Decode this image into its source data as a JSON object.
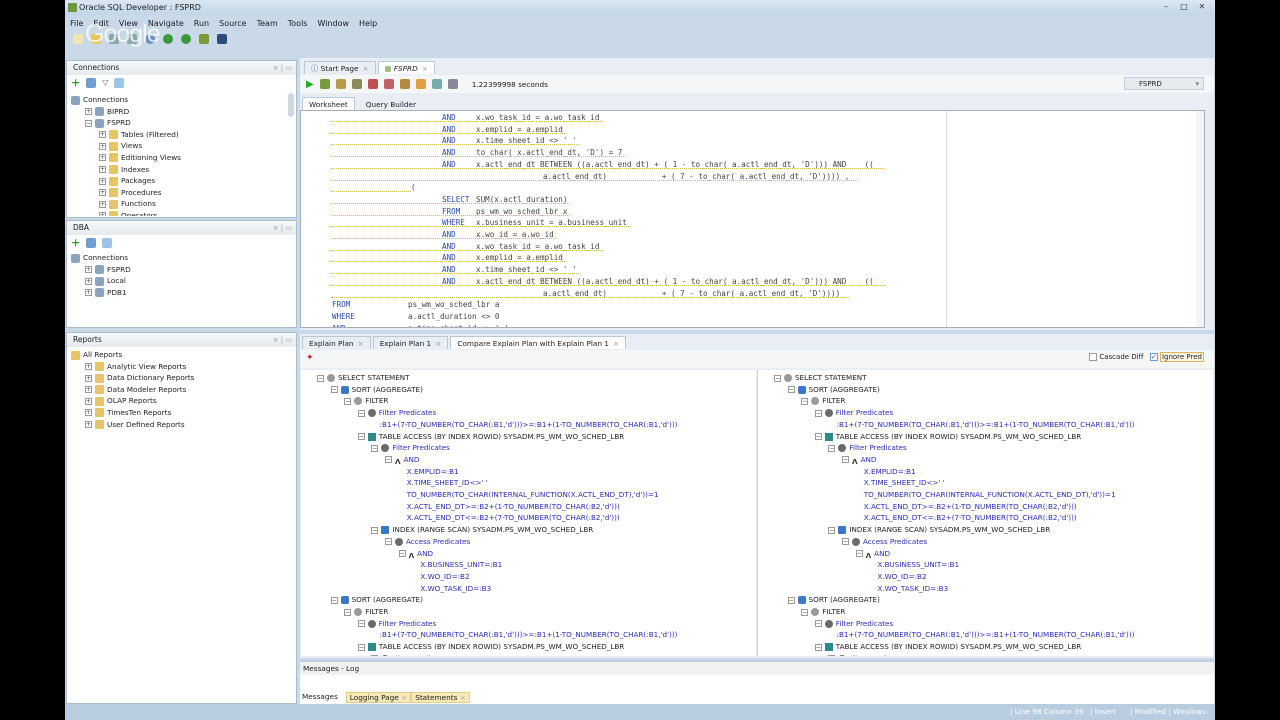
{
  "window": {
    "title": "Oracle SQL Developer : FSPRD",
    "watermark": "Google"
  },
  "menu": [
    "File",
    "Edit",
    "View",
    "Navigate",
    "Run",
    "Source",
    "Team",
    "Tools",
    "Window",
    "Help"
  ],
  "connections_panel": {
    "title": "Connections",
    "tree": [
      {
        "label": "Connections",
        "level": 0,
        "icon": "connections",
        "exp": ""
      },
      {
        "label": "BIPRD",
        "level": 1,
        "icon": "db",
        "exp": "+"
      },
      {
        "label": "FSPRD",
        "level": 1,
        "icon": "db",
        "exp": "-"
      },
      {
        "label": "Tables (Filtered)",
        "level": 2,
        "icon": "folder",
        "exp": "+"
      },
      {
        "label": "Views",
        "level": 2,
        "icon": "folder",
        "exp": "+"
      },
      {
        "label": "Editioning Views",
        "level": 2,
        "icon": "folder",
        "exp": "+"
      },
      {
        "label": "Indexes",
        "level": 2,
        "icon": "folder",
        "exp": "+"
      },
      {
        "label": "Packages",
        "level": 2,
        "icon": "folder",
        "exp": "+"
      },
      {
        "label": "Procedures",
        "level": 2,
        "icon": "folder",
        "exp": "+"
      },
      {
        "label": "Functions",
        "level": 2,
        "icon": "folder",
        "exp": "+"
      },
      {
        "label": "Operators",
        "level": 2,
        "icon": "folder",
        "exp": "+"
      }
    ]
  },
  "dba_panel": {
    "title": "DBA",
    "tree": [
      {
        "label": "Connections",
        "level": 0,
        "icon": "connections",
        "exp": ""
      },
      {
        "label": "FSPRD",
        "level": 1,
        "icon": "db",
        "exp": "+"
      },
      {
        "label": "Local",
        "level": 1,
        "icon": "db",
        "exp": "+"
      },
      {
        "label": "PDB1",
        "level": 1,
        "icon": "db",
        "exp": "+"
      }
    ]
  },
  "reports_panel": {
    "title": "Reports",
    "tree": [
      {
        "label": "All Reports",
        "level": 0,
        "icon": "folder",
        "exp": ""
      },
      {
        "label": "Analytic View Reports",
        "level": 1,
        "icon": "folder",
        "exp": "+"
      },
      {
        "label": "Data Dictionary Reports",
        "level": 1,
        "icon": "folder",
        "exp": "+"
      },
      {
        "label": "Data Modeler Reports",
        "level": 1,
        "icon": "folder",
        "exp": "+"
      },
      {
        "label": "OLAP Reports",
        "level": 1,
        "icon": "folder",
        "exp": "+"
      },
      {
        "label": "TimesTen Reports",
        "level": 1,
        "icon": "folder",
        "exp": "+"
      },
      {
        "label": "User Defined Reports",
        "level": 1,
        "icon": "folder",
        "exp": "+"
      }
    ]
  },
  "editor_tabs": [
    {
      "label": "Start Page",
      "active": false
    },
    {
      "label": "FSPRD",
      "active": true
    }
  ],
  "editor_toolbar": {
    "elapsed": "1.22399998 seconds",
    "connection": "FSPRD"
  },
  "worksheet_tabs": [
    "Worksheet",
    "Query Builder"
  ],
  "code_lines": [
    {
      "col": "inner",
      "kw": "AND",
      "code": "x.wo_task_id = a.wo_task_id"
    },
    {
      "col": "inner",
      "kw": "AND",
      "code": "x.emplid = a.emplid"
    },
    {
      "col": "inner",
      "kw": "AND",
      "code": "x.time_sheet_id <> ' '"
    },
    {
      "col": "inner",
      "kw": "AND",
      "code": "to_char( x.actl_end_dt, 'D') = 7"
    },
    {
      "col": "inner",
      "kw": "AND",
      "code": "x.actl_end_dt BETWEEN ((a.actl_end_dt) + ( 1 - to_char( a.actl_end_dt, 'D'))) AND    (("
    },
    {
      "col": "cont",
      "kw": "",
      "code": "a.actl_end_dt)            + ( 7 - to_char( a.actl_end_dt, 'D')))) ,"
    },
    {
      "col": "paren",
      "kw": "",
      "code": "("
    },
    {
      "col": "inner",
      "kw": "SELECT",
      "code": "SUM(x.actl_duration)"
    },
    {
      "col": "inner",
      "kw": "FROM",
      "code": "ps_wm_wo_sched_lbr x"
    },
    {
      "col": "inner",
      "kw": "WHERE",
      "code": "x.business_unit = a.business_unit"
    },
    {
      "col": "inner",
      "kw": "AND",
      "code": "x.wo_id = a.wo_id"
    },
    {
      "col": "inner",
      "kw": "AND",
      "code": "x.wo_task_id = a.wo_task_id"
    },
    {
      "col": "inner",
      "kw": "AND",
      "code": "x.emplid = a.emplid"
    },
    {
      "col": "inner",
      "kw": "AND",
      "code": "x.time_sheet_id <> ' '"
    },
    {
      "col": "inner",
      "kw": "AND",
      "code": "x.actl_end_dt BETWEEN ((a.actl_end_dt) + ( 1 - to_char( a.actl_end_dt, 'D'))) AND    (("
    },
    {
      "col": "cont",
      "kw": "",
      "code": "a.actl_end_dt)            + ( 7 - to_char( a.actl_end_dt, 'D'))))"
    },
    {
      "col": "outer",
      "kw": "FROM",
      "code": "ps_wm_wo_sched_lbr a"
    },
    {
      "col": "outer",
      "kw": "WHERE",
      "code": "a.actl_duration <> 0"
    },
    {
      "col": "outer",
      "kw": "AND",
      "code": "a.time_sheet_id <> ' '"
    }
  ],
  "plan_tabs": [
    {
      "label": "Explain Plan"
    },
    {
      "label": "Explain Plan 1"
    },
    {
      "label": "Compare Explain Plan with Explain Plan 1",
      "active": true
    }
  ],
  "plan_options": {
    "cascade_diff": "Cascade Diff",
    "cascade_checked": false,
    "ignore_pred": "Ignore Pred",
    "ignore_checked": true
  },
  "plans": [
    {
      "nodes": [
        {
          "t": "SELECT STATEMENT",
          "l": 0,
          "i": "circle"
        },
        {
          "t": "SORT (AGGREGATE)",
          "l": 1,
          "i": "sort"
        },
        {
          "t": "FILTER",
          "l": 2,
          "i": "circle"
        },
        {
          "t": "Filter Predicates",
          "l": 3,
          "i": "filter",
          "b": 1
        },
        {
          "t": ":B1+(7-TO_NUMBER(TO_CHAR(:B1,'d')))>=:B1+(1-TO_NUMBER(TO_CHAR(:B1,'d')))",
          "l": 4.6,
          "i": "",
          "b": 1
        },
        {
          "t": "TABLE ACCESS (BY INDEX ROWID) SYSADM.PS_WM_WO_SCHED_LBR",
          "l": 3,
          "i": "table"
        },
        {
          "t": "Filter Predicates",
          "l": 4,
          "i": "filter",
          "b": 1
        },
        {
          "t": "AND",
          "l": 5,
          "i": "and",
          "b": 1
        },
        {
          "t": "X.EMPLID=:B1",
          "l": 6.6,
          "i": "",
          "b": 1
        },
        {
          "t": "X.TIME_SHEET_ID<>' '",
          "l": 6.6,
          "i": "",
          "b": 1
        },
        {
          "t": "TO_NUMBER(TO_CHAR(INTERNAL_FUNCTION(X.ACTL_END_DT),'d'))=1",
          "l": 6.6,
          "i": "",
          "b": 1
        },
        {
          "t": "X.ACTL_END_DT>=:B2+(1-TO_NUMBER(TO_CHAR(:B2,'d')))",
          "l": 6.6,
          "i": "",
          "b": 1
        },
        {
          "t": "X.ACTL_END_DT<=:B2+(7-TO_NUMBER(TO_CHAR(:B2,'d')))",
          "l": 6.6,
          "i": "",
          "b": 1
        },
        {
          "t": "INDEX (RANGE SCAN) SYSADM.PS_WM_WO_SCHED_LBR",
          "l": 4,
          "i": "index"
        },
        {
          "t": "Access Predicates",
          "l": 5,
          "i": "filter",
          "b": 1
        },
        {
          "t": "AND",
          "l": 6,
          "i": "and",
          "b": 1
        },
        {
          "t": "X.BUSINESS_UNIT=:B1",
          "l": 7.6,
          "i": "",
          "b": 1
        },
        {
          "t": "X.WO_ID=:B2",
          "l": 7.6,
          "i": "",
          "b": 1
        },
        {
          "t": "X.WO_TASK_ID=:B3",
          "l": 7.6,
          "i": "",
          "b": 1
        },
        {
          "t": "SORT (AGGREGATE)",
          "l": 1,
          "i": "sort"
        },
        {
          "t": "FILTER",
          "l": 2,
          "i": "circle"
        },
        {
          "t": "Filter Predicates",
          "l": 3,
          "i": "filter",
          "b": 1
        },
        {
          "t": ":B1+(7-TO_NUMBER(TO_CHAR(:B1,'d')))>=:B1+(1-TO_NUMBER(TO_CHAR(:B1,'d')))",
          "l": 4.6,
          "i": "",
          "b": 1
        },
        {
          "t": "TABLE ACCESS (BY INDEX ROWID) SYSADM.PS_WM_WO_SCHED_LBR",
          "l": 3,
          "i": "table"
        },
        {
          "t": "Filter Predicates",
          "l": 4,
          "i": "filter",
          "b": 1
        }
      ]
    },
    {
      "nodes": [
        {
          "t": "SELECT STATEMENT",
          "l": 0,
          "i": "circle"
        },
        {
          "t": "SORT (AGGREGATE)",
          "l": 1,
          "i": "sort"
        },
        {
          "t": "FILTER",
          "l": 2,
          "i": "circle"
        },
        {
          "t": "Filter Predicates",
          "l": 3,
          "i": "filter",
          "b": 1
        },
        {
          "t": ":B1+(7-TO_NUMBER(TO_CHAR(:B1,'d')))>=:B1+(1-TO_NUMBER(TO_CHAR(:B1,'d')))",
          "l": 4.6,
          "i": "",
          "b": 1
        },
        {
          "t": "TABLE ACCESS (BY INDEX ROWID) SYSADM.PS_WM_WO_SCHED_LBR",
          "l": 3,
          "i": "table"
        },
        {
          "t": "Filter Predicates",
          "l": 4,
          "i": "filter",
          "b": 1
        },
        {
          "t": "AND",
          "l": 5,
          "i": "and",
          "b": 1
        },
        {
          "t": "X.EMPLID=:B1",
          "l": 6.6,
          "i": "",
          "b": 1
        },
        {
          "t": "X.TIME_SHEET_ID<>' '",
          "l": 6.6,
          "i": "",
          "b": 1
        },
        {
          "t": "TO_NUMBER(TO_CHAR(INTERNAL_FUNCTION(X.ACTL_END_DT),'d'))=1",
          "l": 6.6,
          "i": "",
          "b": 1
        },
        {
          "t": "X.ACTL_END_DT>=:B2+(1-TO_NUMBER(TO_CHAR(:B2,'d')))",
          "l": 6.6,
          "i": "",
          "b": 1
        },
        {
          "t": "X.ACTL_END_DT<=:B2+(7-TO_NUMBER(TO_CHAR(:B2,'d')))",
          "l": 6.6,
          "i": "",
          "b": 1
        },
        {
          "t": "INDEX (RANGE SCAN) SYSADM.PS_WM_WO_SCHED_LBR",
          "l": 4,
          "i": "index"
        },
        {
          "t": "Access Predicates",
          "l": 5,
          "i": "filter",
          "b": 1
        },
        {
          "t": "AND",
          "l": 6,
          "i": "and",
          "b": 1
        },
        {
          "t": "X.BUSINESS_UNIT=:B1",
          "l": 7.6,
          "i": "",
          "b": 1
        },
        {
          "t": "X.WO_ID=:B2",
          "l": 7.6,
          "i": "",
          "b": 1
        },
        {
          "t": "X.WO_TASK_ID=:B3",
          "l": 7.6,
          "i": "",
          "b": 1
        },
        {
          "t": "SORT (AGGREGATE)",
          "l": 1,
          "i": "sort"
        },
        {
          "t": "FILTER",
          "l": 2,
          "i": "circle"
        },
        {
          "t": "Filter Predicates",
          "l": 3,
          "i": "filter",
          "b": 1
        },
        {
          "t": ":B1+(7-TO_NUMBER(TO_CHAR(:B1,'d')))>=:B1+(1-TO_NUMBER(TO_CHAR(:B1,'d')))",
          "l": 4.6,
          "i": "",
          "b": 1
        },
        {
          "t": "TABLE ACCESS (BY INDEX ROWID) SYSADM.PS_WM_WO_SCHED_LBR",
          "l": 3,
          "i": "table"
        },
        {
          "t": "Filter Predicates",
          "l": 4,
          "i": "filter",
          "b": 1
        }
      ]
    }
  ],
  "messages": {
    "title": "Messages - Log",
    "tabs": [
      "Messages",
      "Logging Page",
      "Statements"
    ]
  },
  "status": {
    "position": "Line 98 Column 39",
    "mode": "Insert",
    "modified": "Modified",
    "encoding": "Windows: CP"
  }
}
